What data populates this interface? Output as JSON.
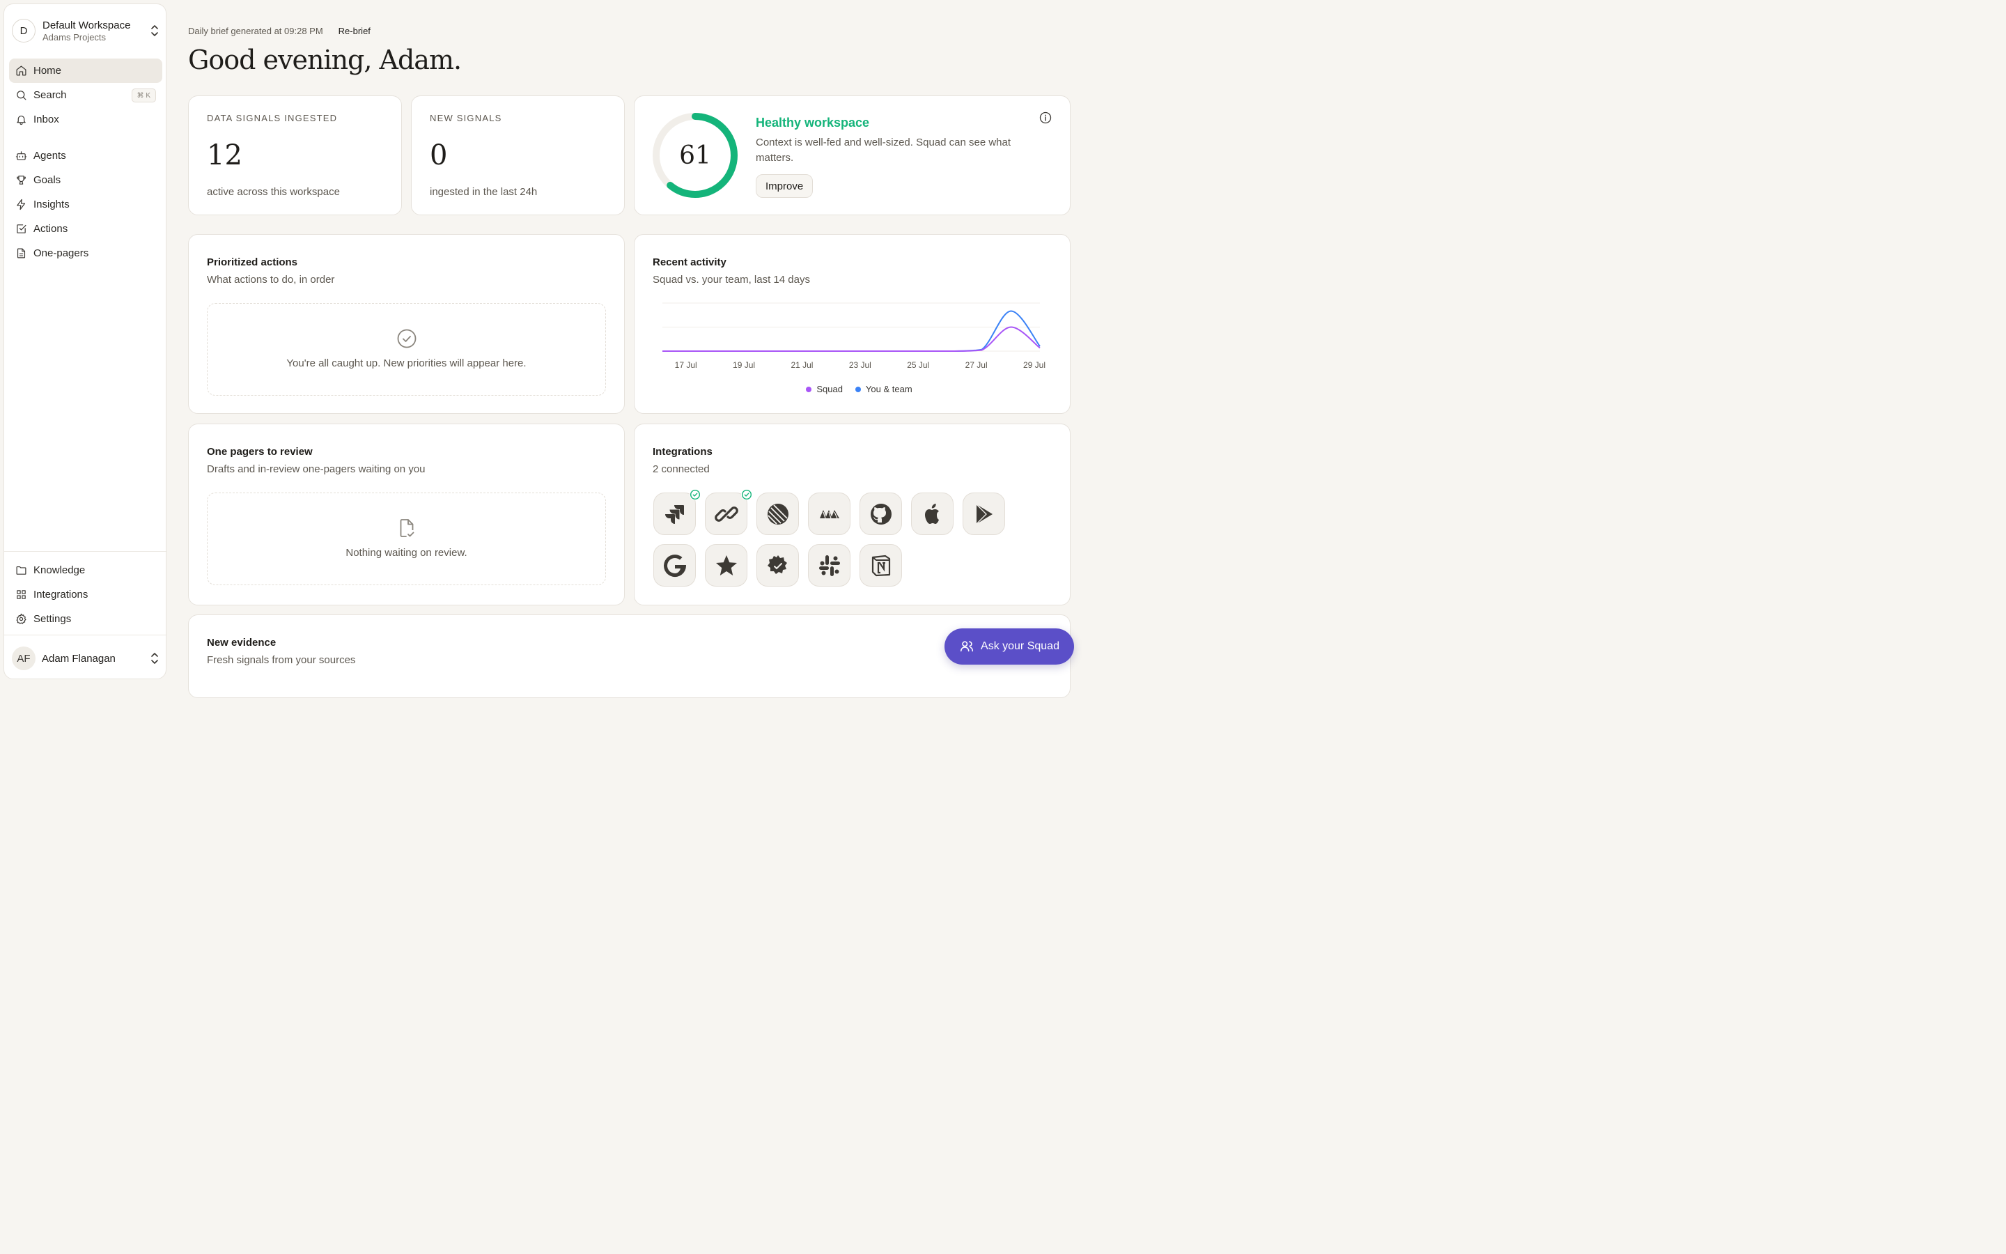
{
  "sidebar": {
    "workspace": {
      "initial": "D",
      "name": "Default Workspace",
      "project": "Adams Projects"
    },
    "primary_nav": [
      {
        "label": "Home",
        "icon": "home-icon",
        "active": true
      },
      {
        "label": "Search",
        "icon": "search-icon",
        "shortcut": "⌘ K"
      },
      {
        "label": "Inbox",
        "icon": "bell-icon"
      }
    ],
    "secondary_nav": [
      {
        "label": "Agents",
        "icon": "bot-icon"
      },
      {
        "label": "Goals",
        "icon": "trophy-icon"
      },
      {
        "label": "Insights",
        "icon": "lightning-icon"
      },
      {
        "label": "Actions",
        "icon": "checkbox-icon"
      },
      {
        "label": "One-pagers",
        "icon": "document-icon"
      }
    ],
    "bottom_nav": [
      {
        "label": "Knowledge",
        "icon": "folder-icon"
      },
      {
        "label": "Integrations",
        "icon": "grid-icon"
      },
      {
        "label": "Settings",
        "icon": "gear-icon"
      }
    ],
    "user": {
      "initials": "AF",
      "name": "Adam Flanagan"
    }
  },
  "header": {
    "brief_text": "Daily brief generated at 09:28 PM",
    "rebrief_label": "Re-brief",
    "greeting": "Good evening, Adam."
  },
  "stats": {
    "signals_ingested": {
      "label": "DATA SIGNALS INGESTED",
      "value": "12",
      "sub": "active across this workspace"
    },
    "new_signals": {
      "label": "NEW SIGNALS",
      "value": "0",
      "sub": "ingested in the last 24h"
    }
  },
  "health": {
    "score": "61",
    "score_fraction": 0.61,
    "title": "Healthy workspace",
    "description": "Context is well-fed and well-sized. Squad can see what matters.",
    "button_label": "Improve",
    "color": "#14b47a"
  },
  "prioritized": {
    "title": "Prioritized actions",
    "subtitle": "What actions to do, in order",
    "empty_text": "You're all caught up. New priorities will appear here."
  },
  "activity": {
    "title": "Recent activity",
    "subtitle": "Squad vs. your team, last 14 days"
  },
  "chart_data": {
    "type": "line",
    "x": [
      "16 Jul",
      "17 Jul",
      "18 Jul",
      "19 Jul",
      "20 Jul",
      "21 Jul",
      "22 Jul",
      "23 Jul",
      "24 Jul",
      "25 Jul",
      "26 Jul",
      "27 Jul",
      "28 Jul",
      "29 Jul"
    ],
    "tick_labels": [
      "17 Jul",
      "19 Jul",
      "21 Jul",
      "23 Jul",
      "25 Jul",
      "27 Jul",
      "29 Jul"
    ],
    "series": [
      {
        "name": "Squad",
        "color": "#a855f7",
        "values": [
          0,
          0,
          0,
          0,
          0,
          0,
          0,
          0,
          0,
          0,
          0,
          0.2,
          4.5,
          0.6
        ]
      },
      {
        "name": "You & team",
        "color": "#3b82f6",
        "values": [
          0,
          0,
          0,
          0,
          0,
          0,
          0,
          0,
          0,
          0,
          0,
          0.3,
          7.5,
          0.9
        ]
      }
    ],
    "ylim": [
      0,
      9
    ],
    "grid": true,
    "legend": "bottom"
  },
  "onepagers": {
    "title": "One pagers to review",
    "subtitle": "Drafts and in-review one-pagers waiting on you",
    "empty_text": "Nothing waiting on review."
  },
  "integrations": {
    "title": "Integrations",
    "subtitle": "2 connected",
    "items": [
      {
        "icon": "jira-icon",
        "connected": true
      },
      {
        "icon": "zapier-icon",
        "connected": true
      },
      {
        "icon": "linear-icon",
        "connected": false
      },
      {
        "icon": "airtable-icon",
        "connected": false
      },
      {
        "icon": "github-icon",
        "connected": false
      },
      {
        "icon": "apple-icon",
        "connected": false
      },
      {
        "icon": "play-store-icon",
        "connected": false
      },
      {
        "icon": "google-icon",
        "connected": false
      },
      {
        "icon": "star-icon",
        "connected": false
      },
      {
        "icon": "badge-icon",
        "connected": false
      },
      {
        "icon": "slack-icon",
        "connected": false
      },
      {
        "icon": "notion-icon",
        "connected": false
      }
    ]
  },
  "evidence": {
    "title": "New evidence",
    "subtitle": "Fresh signals from your sources"
  },
  "ask_button": {
    "label": "Ask your Squad",
    "color": "#5b4fc8"
  }
}
